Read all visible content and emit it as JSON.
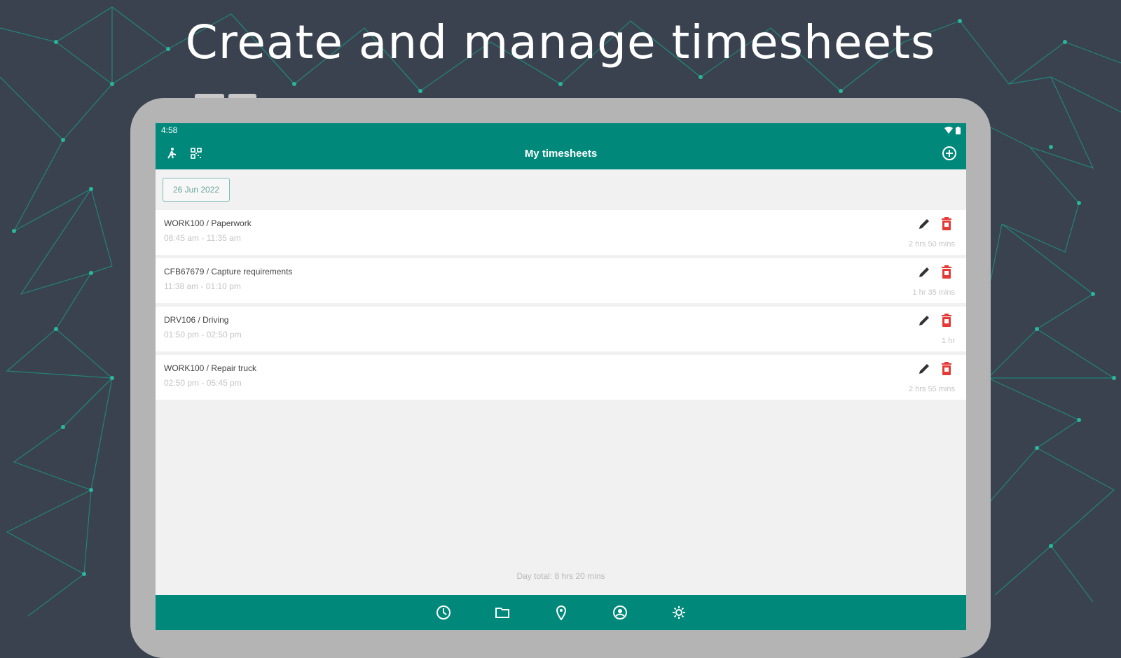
{
  "headline": "Create and manage timesheets",
  "status": {
    "time": "4:58"
  },
  "appbar": {
    "title": "My timesheets"
  },
  "date_chip": "26 Jun 2022",
  "entries": [
    {
      "title": "WORK100 / Paperwork",
      "time": "08:45 am - 11:35 am",
      "duration": "2 hrs 50 mins"
    },
    {
      "title": "CFB67679 / Capture requirements",
      "time": "11:38 am - 01:10 pm",
      "duration": "1 hr 35 mins"
    },
    {
      "title": "DRV106 / Driving",
      "time": "01:50 pm - 02:50 pm",
      "duration": "1 hr"
    },
    {
      "title": "WORK100 / Repair truck",
      "time": "02:50 pm - 05:45 pm",
      "duration": "2 hrs 55 mins"
    }
  ],
  "day_total": "Day total: 8 hrs 20 mins",
  "icons": {
    "appbar_left": [
      "person-walk-icon",
      "qr-code-icon"
    ],
    "appbar_right": "add-circle-icon",
    "entry_actions": [
      "edit-pencil-icon",
      "delete-trash-icon"
    ],
    "bottom_nav": [
      "clock-icon",
      "folder-icon",
      "location-pin-icon",
      "account-icon",
      "settings-gear-icon"
    ]
  },
  "colors": {
    "brand_teal": "#00897b",
    "background": "#3a4250",
    "net_lines": "#1f8f7d",
    "delete_red": "#e53935"
  }
}
